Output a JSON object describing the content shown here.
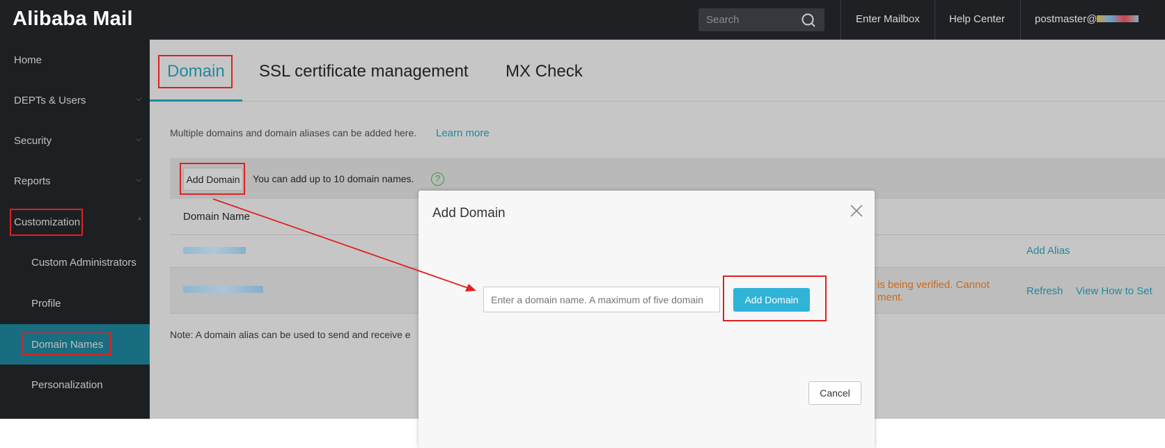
{
  "header": {
    "logo": "Alibaba Mail",
    "search_placeholder": "Search",
    "enter_mailbox": "Enter Mailbox",
    "help_center": "Help Center",
    "user": "postmaster@"
  },
  "sidebar": {
    "items": [
      {
        "label": "Home"
      },
      {
        "label": "DEPTs & Users"
      },
      {
        "label": "Security"
      },
      {
        "label": "Reports"
      },
      {
        "label": "Customization"
      },
      {
        "label": "Custom Administrators"
      },
      {
        "label": "Profile"
      },
      {
        "label": "Domain Names"
      },
      {
        "label": "Personalization"
      }
    ]
  },
  "tabs": [
    {
      "label": "Domain"
    },
    {
      "label": "SSL certificate management"
    },
    {
      "label": "MX Check"
    }
  ],
  "main": {
    "description": "Multiple domains and domain aliases can be added here.",
    "learn_more": "Learn more",
    "add_domain": "Add Domain",
    "limit_text": "You can add up to 10 domain names.",
    "help_icon": "?",
    "col_domain": "Domain Name",
    "row1_action": "Add Alias",
    "row2_status_1": "is being verified. Cannot",
    "row2_status_2": "ment.",
    "row2_refresh": "Refresh",
    "row2_view": "View How to Set",
    "note": "Note: A domain alias can be used to send and receive e"
  },
  "modal": {
    "title": "Add Domain",
    "input_placeholder": "Enter a domain name. A maximum of five domain",
    "add_button": "Add Domain",
    "cancel": "Cancel"
  },
  "colors": {
    "accent": "#1e8aa0",
    "button": "#2fb3d6",
    "annotation": "#e02020",
    "warning": "#c86a1e"
  }
}
